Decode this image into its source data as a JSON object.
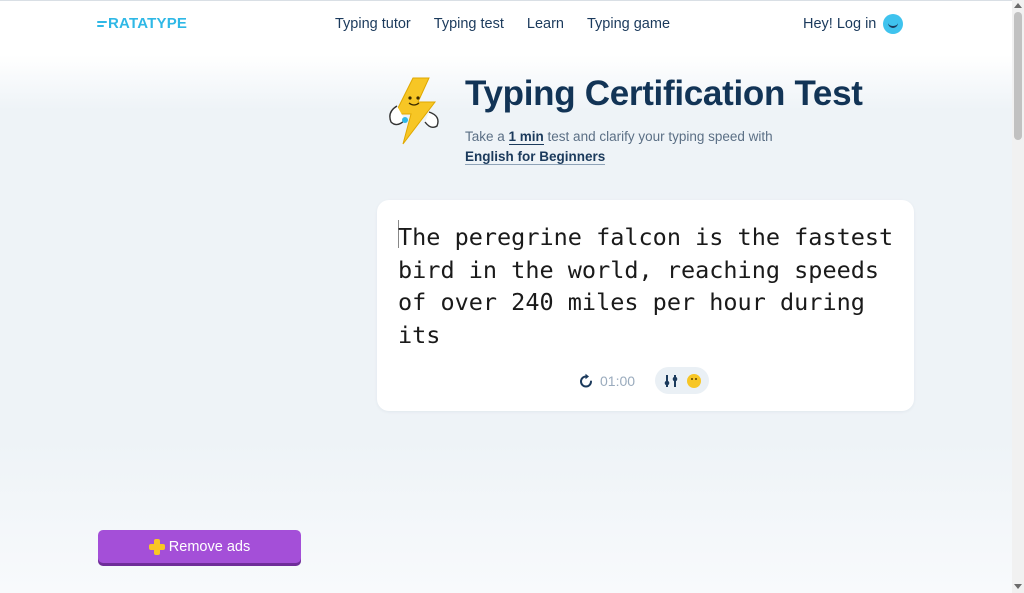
{
  "header": {
    "logo_text": "RATATYPE",
    "nav": [
      "Typing tutor",
      "Typing test",
      "Learn",
      "Typing game"
    ],
    "login_label": "Hey! Log in"
  },
  "hero": {
    "title": "Typing Certification Test",
    "subtitle_prefix": "Take a ",
    "duration": "1 min",
    "subtitle_middle": " test and clarify your typing speed with",
    "course": "English for Beginners"
  },
  "test": {
    "text": "The peregrine falcon is the fastest bird in the world, reaching speeds of over 240 miles per hour during its",
    "timer": "01:00"
  },
  "ads": {
    "remove_label": "Remove ads"
  },
  "icons": {
    "logo": "logo-bars-icon",
    "login": "smiley-icon",
    "timer": "refresh-icon",
    "settings": "sliders-icon",
    "theme": "emoji-icon",
    "remove_ads": "plus-icon"
  },
  "colors": {
    "brand": "#2fb8e6",
    "title": "#123456",
    "remove_ads": "#a44fd8",
    "accent_yellow": "#f9c623"
  }
}
